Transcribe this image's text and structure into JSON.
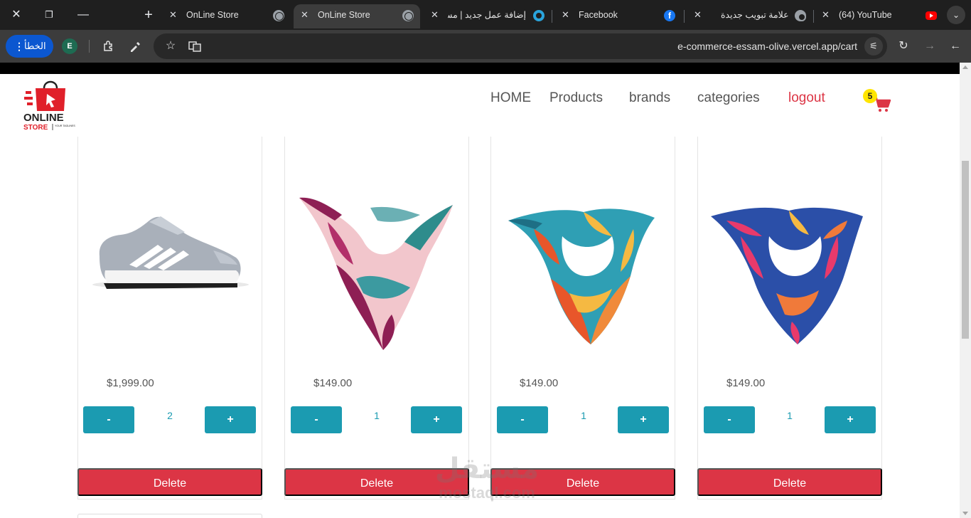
{
  "browser": {
    "tabs": [
      {
        "title": "OnLine Store",
        "favicon": "globe-icon",
        "active": false
      },
      {
        "title": "OnLine Store",
        "favicon": "globe-icon",
        "active": true
      },
      {
        "title": "إضافة عمل جديد | مس",
        "favicon": "mostaql-icon",
        "active": false
      },
      {
        "title": "Facebook",
        "favicon": "facebook-icon",
        "active": false
      },
      {
        "title": "علامة تبويب جديدة",
        "favicon": "chrome-icon",
        "active": false
      },
      {
        "title": "(64) YouTube",
        "favicon": "youtube-icon",
        "active": false
      }
    ],
    "error_button_label": "الخطأ",
    "profile_initial": "E",
    "url": "e-commerce-essam-olive.vercel.app/cart"
  },
  "site": {
    "logo": {
      "line1": "ONLINE",
      "line2": "STORE",
      "tagline": "YOUR TAGLINES"
    },
    "nav": {
      "home": "HOME",
      "products": "Products",
      "brands": "brands",
      "categories": "categories",
      "logout": "logout"
    },
    "cart_count": "5"
  },
  "cart": {
    "items": [
      {
        "image": "sneaker",
        "price": "$1,999.00",
        "quantity": "2",
        "minus_label": "-",
        "plus_label": "+",
        "delete_label": "Delete"
      },
      {
        "image": "scarf-magenta",
        "price": "$149.00",
        "quantity": "1",
        "minus_label": "-",
        "plus_label": "+",
        "delete_label": "Delete"
      },
      {
        "image": "scarf-orange-teal",
        "price": "$149.00",
        "quantity": "1",
        "minus_label": "-",
        "plus_label": "+",
        "delete_label": "Delete"
      },
      {
        "image": "scarf-blue-pink",
        "price": "$149.00",
        "quantity": "1",
        "minus_label": "-",
        "plus_label": "+",
        "delete_label": "Delete"
      }
    ]
  },
  "watermark": {
    "arabic": "مستقل",
    "latin": "mostaql.com"
  },
  "colors": {
    "accent": "#1b9bb1",
    "danger": "#dc3545",
    "badge": "#ffe500"
  }
}
